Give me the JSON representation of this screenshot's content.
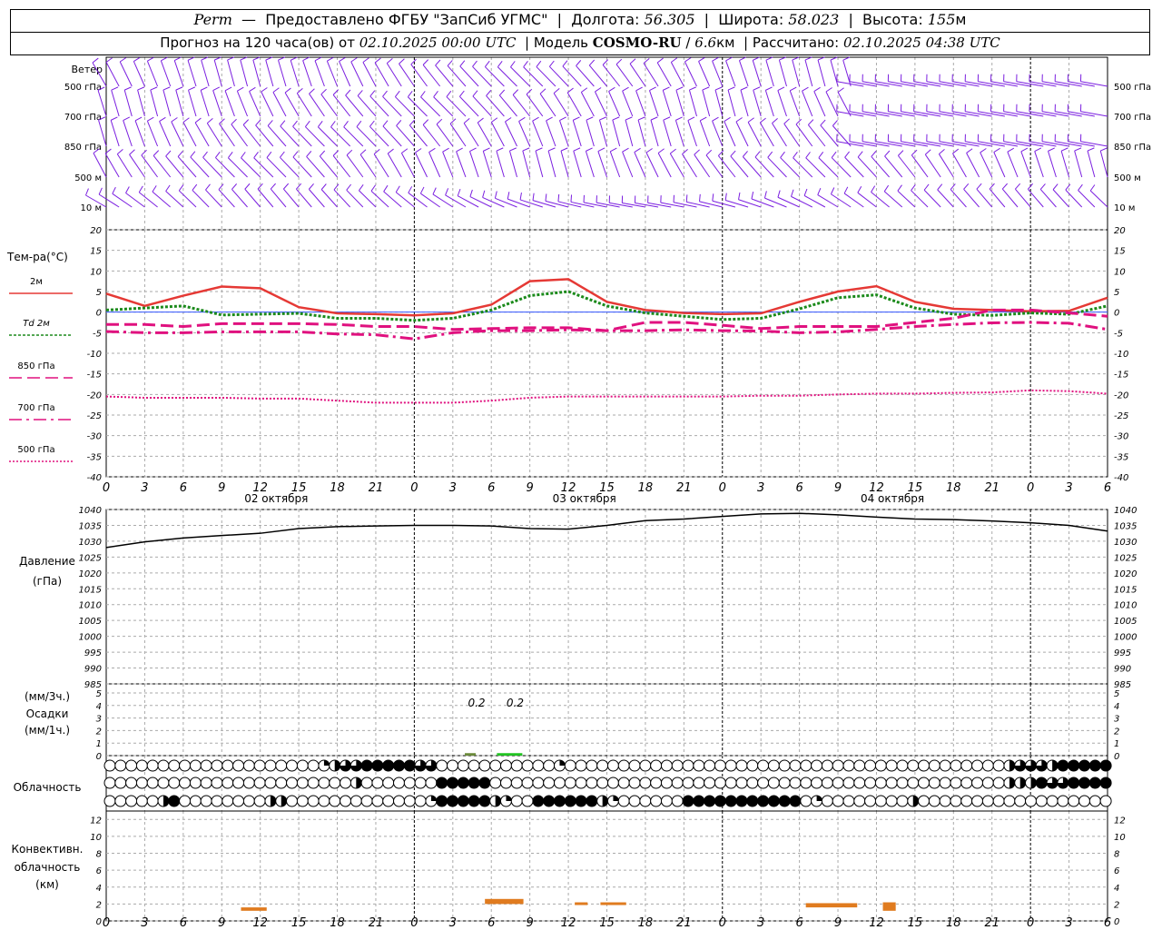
{
  "header": {
    "station": "Perm",
    "provider": "Предоставлено ФГБУ \"ЗапСиб УГМС\"",
    "lon_label": "Долгота:",
    "lon": "56.305",
    "lat_label": "Широта:",
    "lat": "58.023",
    "alt_label": "Высота:",
    "alt": "155",
    "alt_unit": "м",
    "forecast_prefix": "Прогноз на 120 часа(ов) от",
    "forecast_time": "02.10.2025 00:00 UTC",
    "model_label": "Модель",
    "model": "COSMO-RU",
    "model_res": "6.6",
    "model_res_unit": "км",
    "computed_label": "Рассчитано:",
    "computed_time": "02.10.2025 04:38 UTC"
  },
  "chart_data": [
    {
      "type": "wind-barbs",
      "title": "Ветер",
      "levels": [
        "500 гПа",
        "700 гПа",
        "850 гПа",
        "500 м",
        "10 м"
      ],
      "colors": {
        "barb": "#7b1fe0"
      }
    },
    {
      "type": "line",
      "ylabel": "Тем-ра(°C)",
      "ylim": [
        -40,
        20
      ],
      "yticks": [
        20,
        15,
        10,
        5,
        0,
        -5,
        -10,
        -15,
        -20,
        -25,
        -30,
        -35,
        -40
      ],
      "x_hours": [
        0,
        3,
        6,
        9,
        12,
        15,
        18,
        21,
        24,
        27,
        30,
        33,
        36,
        39,
        42,
        45,
        48,
        51,
        54,
        57,
        60,
        63,
        66,
        69,
        72,
        75,
        78
      ],
      "series": [
        {
          "name": "2м",
          "color": "#e53935",
          "style": "solid",
          "values": [
            4.5,
            1.5,
            4,
            6.2,
            5.8,
            1.2,
            -0.3,
            -0.5,
            -0.8,
            -0.3,
            1.8,
            7.5,
            8,
            2.5,
            0.5,
            -0.2,
            -0.5,
            -0.3,
            2.5,
            5,
            6.3,
            2.5,
            0.8,
            0.5,
            0.2,
            0.3,
            3.5
          ]
        },
        {
          "name": "Td 2м",
          "color": "#1b8a1b",
          "style": "dotted",
          "values": [
            0.5,
            1,
            1.5,
            -0.7,
            -0.5,
            -0.3,
            -1.5,
            -1.5,
            -2,
            -1.5,
            0.5,
            4,
            5,
            1.5,
            -0.2,
            -1,
            -1.8,
            -1.5,
            0.8,
            3.5,
            4.2,
            1,
            -0.5,
            -0.8,
            -0.2,
            -0.5,
            1.5
          ]
        },
        {
          "name": "850 гПа",
          "color": "#e0117f",
          "style": "dashed",
          "values": [
            -3,
            -3,
            -3.5,
            -2.8,
            -2.8,
            -2.8,
            -3,
            -3.5,
            -3.5,
            -4.2,
            -4,
            -3.8,
            -3.8,
            -4.5,
            -2.5,
            -2.5,
            -3.2,
            -4,
            -3.5,
            -3.5,
            -3.5,
            -2.5,
            -1.5,
            0.5,
            0.5,
            -0.2,
            -1
          ]
        },
        {
          "name": "700 гПа",
          "color": "#e0117f",
          "style": "dashdot",
          "values": [
            -4.7,
            -5,
            -5,
            -4.8,
            -4.8,
            -4.8,
            -5.3,
            -5.5,
            -6.5,
            -5,
            -4.5,
            -4.5,
            -4.3,
            -4.5,
            -4.5,
            -4.3,
            -4.5,
            -4.6,
            -5,
            -4.8,
            -4.2,
            -3.5,
            -3,
            -2.6,
            -2.5,
            -2.7,
            -4.2
          ]
        },
        {
          "name": "500 гПа",
          "color": "#e0117f",
          "style": "fine-dotted",
          "values": [
            -20.5,
            -20.8,
            -20.8,
            -20.8,
            -21,
            -21,
            -21.5,
            -22,
            -22,
            -22,
            -21.5,
            -20.8,
            -20.5,
            -20.5,
            -20.5,
            -20.5,
            -20.5,
            -20.3,
            -20.3,
            -20,
            -19.8,
            -19.8,
            -19.6,
            -19.5,
            -19,
            -19.2,
            -19.8
          ]
        }
      ],
      "x_labels": [
        "0",
        "3",
        "6",
        "9",
        "12",
        "15",
        "18",
        "21",
        "0",
        "3",
        "6",
        "9",
        "12",
        "15",
        "18",
        "21",
        "0",
        "3",
        "6",
        "9",
        "12",
        "15",
        "18",
        "21",
        "0",
        "3",
        "6"
      ],
      "day_labels": [
        "02 октября",
        "03 октября",
        "04 октября"
      ]
    },
    {
      "type": "line",
      "ylabel": "Давление",
      "ylabel2": "(гПа)",
      "ylim": [
        985,
        1040
      ],
      "yticks": [
        1040,
        1035,
        1030,
        1025,
        1020,
        1015,
        1010,
        1005,
        1000,
        995,
        990,
        985
      ],
      "series": [
        {
          "name": "Давление",
          "color": "#000000",
          "values": [
            1028,
            1029.8,
            1031,
            1031.8,
            1032.5,
            1034,
            1034.6,
            1034.8,
            1035,
            1035,
            1034.8,
            1034,
            1033.8,
            1035,
            1036.5,
            1037,
            1037.8,
            1038.6,
            1038.8,
            1038.3,
            1037.6,
            1037,
            1036.8,
            1036.4,
            1035.8,
            1035,
            1033.2
          ]
        }
      ]
    },
    {
      "type": "bar",
      "ylabel_top": "(мм/3ч.)",
      "ylabel_mid": "Осадки",
      "ylabel_bot": "(мм/1ч.)",
      "ylim": [
        0,
        5
      ],
      "yticks": [
        5,
        4,
        3,
        2,
        1,
        0
      ],
      "annotations": [
        {
          "x_hour": 28.5,
          "text": "0.2"
        },
        {
          "x_hour": 31.5,
          "text": "0.2"
        }
      ],
      "bars": [
        {
          "x_hour": 28.5,
          "value": 0.2,
          "color": "#6b8a3a"
        },
        {
          "x_hour": 31,
          "value": 0.2,
          "color": "#22c322"
        }
      ]
    },
    {
      "type": "cloud-cover",
      "ylabel": "Облачность",
      "rows": [
        "0000000000000000000012334444433000000000001000000000000000000000000000000000000000002333244444",
        "0000000000000000000000020000000444440000000000000000000000000000000000000000000000002224334444",
        "0000024000000002200000000000001444442100444444210000004444444444401000000002000000000000000000"
      ]
    },
    {
      "type": "bar",
      "ylabel1": "Конвективн.",
      "ylabel2": "облачность",
      "ylabel3": "(км)",
      "ylim": [
        0,
        13
      ],
      "yticks": [
        12,
        10,
        8,
        6,
        4,
        2,
        0
      ],
      "segments": [
        {
          "x0": 10.5,
          "x1": 12.5,
          "base": 1.2,
          "top": 1.6
        },
        {
          "x0": 29.5,
          "x1": 32.5,
          "base": 2,
          "top": 2.6
        },
        {
          "x0": 36.5,
          "x1": 37.5,
          "base": 1.9,
          "top": 2.2
        },
        {
          "x0": 38.5,
          "x1": 40.5,
          "base": 1.9,
          "top": 2.2
        },
        {
          "x0": 54.5,
          "x1": 58.5,
          "base": 1.6,
          "top": 2.1
        },
        {
          "x0": 60.5,
          "x1": 61.5,
          "base": 1.2,
          "top": 2.2
        }
      ],
      "color": "#e07b1f"
    }
  ]
}
